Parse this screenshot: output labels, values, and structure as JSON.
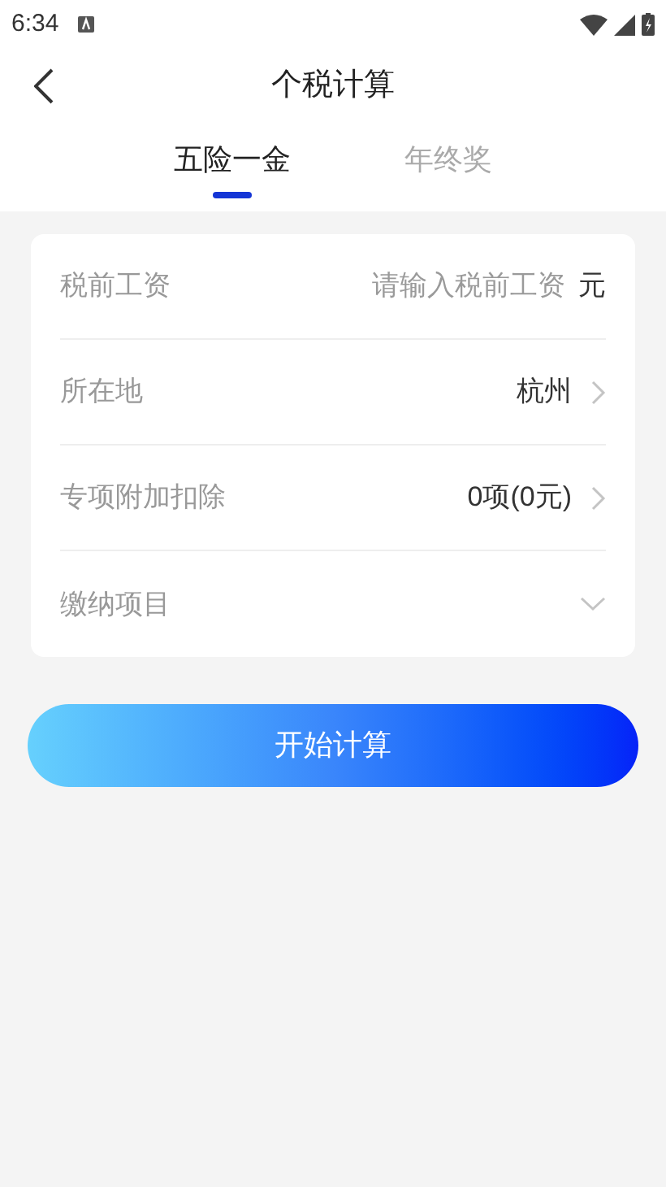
{
  "status_bar": {
    "time": "6:34"
  },
  "header": {
    "title": "个税计算"
  },
  "tabs": [
    {
      "label": "五险一金",
      "selected": true
    },
    {
      "label": "年终奖",
      "selected": false
    }
  ],
  "form": {
    "rows": [
      {
        "kind": "input",
        "label": "税前工资",
        "placeholder": "请输入税前工资",
        "unit": "元"
      },
      {
        "kind": "link",
        "label": "所在地",
        "value": "杭州"
      },
      {
        "kind": "link",
        "label": "专项附加扣除",
        "value": "0项(0元)"
      },
      {
        "kind": "select",
        "label": "缴纳项目"
      }
    ]
  },
  "button": {
    "label": "开始计算"
  }
}
